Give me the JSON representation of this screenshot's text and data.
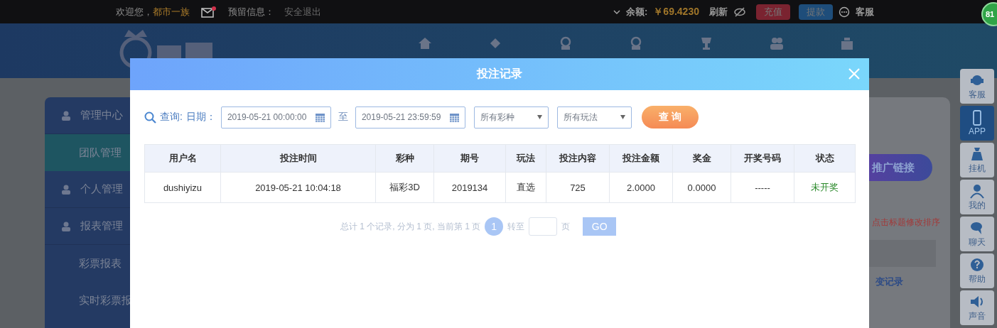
{
  "top_bar": {
    "welcome": "欢迎您，",
    "username": "都市一族",
    "has_unread_mail": true,
    "reserved_info_label": "预留信息：",
    "logout": "安全退出",
    "balance_label": "余额:",
    "balance": "￥69.4230",
    "refresh": "刷新",
    "recharge": "充值",
    "withdraw": "提款",
    "service": "客服",
    "badge": "81"
  },
  "sidebar": {
    "items": [
      {
        "label": "管理中心",
        "kind": "section",
        "selected": false
      },
      {
        "label": "团队管理",
        "kind": "sub",
        "selected": true
      },
      {
        "label": "个人管理",
        "kind": "section",
        "selected": false
      },
      {
        "label": "报表管理",
        "kind": "section",
        "selected": false
      },
      {
        "label": "彩票报表",
        "kind": "sub",
        "selected": false
      },
      {
        "label": "实时彩票报",
        "kind": "sub",
        "selected": false
      }
    ]
  },
  "main": {
    "promo_button": "推广链接",
    "hint": "点击标题修改排序",
    "link": "变记录"
  },
  "right_rail": [
    {
      "label": "客服",
      "kind": "headset",
      "selected": false
    },
    {
      "label": "APP",
      "kind": "phone",
      "selected": true
    },
    {
      "label": "挂机",
      "kind": "bag",
      "selected": false
    },
    {
      "label": "我的",
      "kind": "person",
      "selected": false
    },
    {
      "label": "聊天",
      "kind": "chat",
      "selected": false
    },
    {
      "label": "帮助",
      "kind": "help",
      "selected": false
    },
    {
      "label": "声音",
      "kind": "speaker",
      "selected": false
    }
  ],
  "modal": {
    "title": "投注记录",
    "query_label": "查询:",
    "date_label": "日期：",
    "start": "2019-05-21 00:00:00",
    "to": "至",
    "end": "2019-05-21 23:59:59",
    "lottery_select": "所有彩种",
    "play_select": "所有玩法",
    "query_button": "查 询",
    "table": {
      "columns": [
        "用户名",
        "投注时间",
        "彩种",
        "期号",
        "玩法",
        "投注内容",
        "投注金额",
        "奖金",
        "开奖号码",
        "状态"
      ],
      "rows": [
        [
          "dushiyizu",
          "2019-05-21 10:04:18",
          "福彩3D",
          "2019134",
          "直选",
          "725",
          "2.0000",
          "0.0000",
          "-----",
          "未开奖"
        ]
      ]
    },
    "pagination": {
      "summary": "总计 1 个记录, 分为 1 页, 当前第 1 页",
      "pages": [
        {
          "label": "1",
          "selected": true
        }
      ],
      "goto_label": "转至",
      "page_unit": "页",
      "go": "GO"
    }
  }
}
